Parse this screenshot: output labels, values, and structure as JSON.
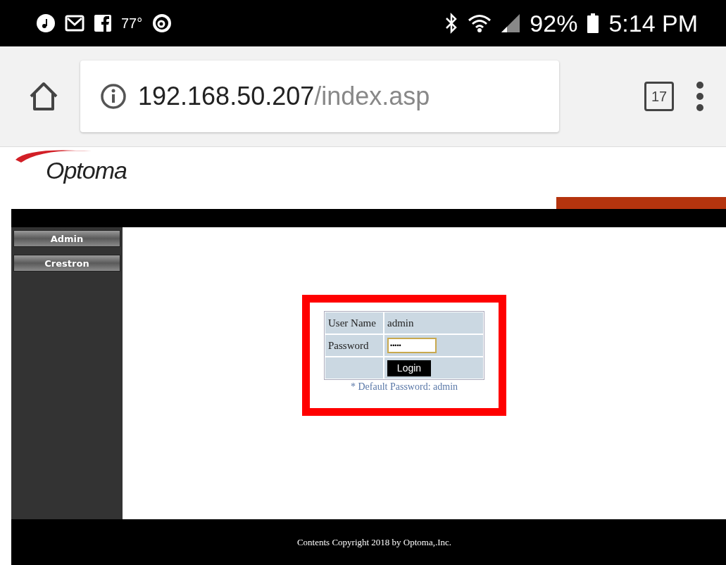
{
  "status_bar": {
    "notification_temp": "77°",
    "battery": "92%",
    "time": "5:14 PM"
  },
  "browser": {
    "url_host": "192.168.50.207",
    "url_path": "/index.asp",
    "tab_count": "17"
  },
  "logo": {
    "text": "Optoma"
  },
  "sidebar": {
    "items": [
      {
        "label": "Admin"
      },
      {
        "label": "Crestron"
      }
    ]
  },
  "login": {
    "user_label": "User Name",
    "user_value": "admin",
    "password_label": "Password",
    "password_value": "•••••",
    "button": "Login",
    "hint": "* Default Password: admin"
  },
  "footer": {
    "text": "Contents Copyright 2018 by Optoma,.Inc."
  }
}
